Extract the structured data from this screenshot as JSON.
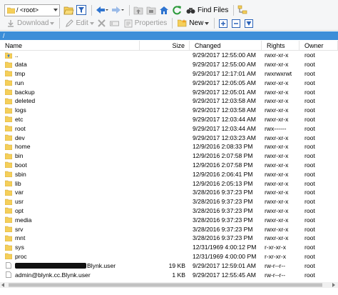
{
  "toolbar1": {
    "dir_select_value": "/ <root>",
    "find_files_label": "Find Files"
  },
  "toolbar2": {
    "download_label": "Download",
    "edit_label": "Edit",
    "properties_label": "Properties",
    "new_label": "New"
  },
  "path": "/",
  "columns": {
    "name": "Name",
    "size": "Size",
    "changed": "Changed",
    "rights": "Rights",
    "owner": "Owner"
  },
  "rows": [
    {
      "name": "..",
      "type": "parent",
      "size": "",
      "changed": "9/29/2017 12:55:00 AM",
      "rights": "rwxr-xr-x",
      "owner": "root"
    },
    {
      "name": "data",
      "type": "folder",
      "size": "",
      "changed": "9/29/2017 12:55:00 AM",
      "rights": "rwxr-xr-x",
      "owner": "root"
    },
    {
      "name": "tmp",
      "type": "folder",
      "size": "",
      "changed": "9/29/2017 12:17:01 AM",
      "rights": "rwxrwxrwt",
      "owner": "root"
    },
    {
      "name": "run",
      "type": "folder",
      "size": "",
      "changed": "9/29/2017 12:05:05 AM",
      "rights": "rwxr-xr-x",
      "owner": "root"
    },
    {
      "name": "backup",
      "type": "folder",
      "size": "",
      "changed": "9/29/2017 12:05:01 AM",
      "rights": "rwxr-xr-x",
      "owner": "root"
    },
    {
      "name": "deleted",
      "type": "folder",
      "size": "",
      "changed": "9/29/2017 12:03:58 AM",
      "rights": "rwxr-xr-x",
      "owner": "root"
    },
    {
      "name": "logs",
      "type": "folder",
      "size": "",
      "changed": "9/29/2017 12:03:58 AM",
      "rights": "rwxr-xr-x",
      "owner": "root"
    },
    {
      "name": "etc",
      "type": "folder",
      "size": "",
      "changed": "9/29/2017 12:03:44 AM",
      "rights": "rwxr-xr-x",
      "owner": "root"
    },
    {
      "name": "root",
      "type": "folder",
      "size": "",
      "changed": "9/29/2017 12:03:44 AM",
      "rights": "rwx------",
      "owner": "root"
    },
    {
      "name": "dev",
      "type": "folder",
      "size": "",
      "changed": "9/29/2017 12:03:23 AM",
      "rights": "rwxr-xr-x",
      "owner": "root"
    },
    {
      "name": "home",
      "type": "folder",
      "size": "",
      "changed": "12/9/2016 2:08:33 PM",
      "rights": "rwxr-xr-x",
      "owner": "root"
    },
    {
      "name": "bin",
      "type": "folder",
      "size": "",
      "changed": "12/9/2016 2:07:58 PM",
      "rights": "rwxr-xr-x",
      "owner": "root"
    },
    {
      "name": "boot",
      "type": "folder",
      "size": "",
      "changed": "12/9/2016 2:07:58 PM",
      "rights": "rwxr-xr-x",
      "owner": "root"
    },
    {
      "name": "sbin",
      "type": "folder",
      "size": "",
      "changed": "12/9/2016 2:06:41 PM",
      "rights": "rwxr-xr-x",
      "owner": "root"
    },
    {
      "name": "lib",
      "type": "folder",
      "size": "",
      "changed": "12/9/2016 2:05:13 PM",
      "rights": "rwxr-xr-x",
      "owner": "root"
    },
    {
      "name": "var",
      "type": "folder",
      "size": "",
      "changed": "3/28/2016 9:37:23 PM",
      "rights": "rwxr-xr-x",
      "owner": "root"
    },
    {
      "name": "usr",
      "type": "folder",
      "size": "",
      "changed": "3/28/2016 9:37:23 PM",
      "rights": "rwxr-xr-x",
      "owner": "root"
    },
    {
      "name": "opt",
      "type": "folder",
      "size": "",
      "changed": "3/28/2016 9:37:23 PM",
      "rights": "rwxr-xr-x",
      "owner": "root"
    },
    {
      "name": "media",
      "type": "folder",
      "size": "",
      "changed": "3/28/2016 9:37:23 PM",
      "rights": "rwxr-xr-x",
      "owner": "root"
    },
    {
      "name": "srv",
      "type": "folder",
      "size": "",
      "changed": "3/28/2016 9:37:23 PM",
      "rights": "rwxr-xr-x",
      "owner": "root"
    },
    {
      "name": "mnt",
      "type": "folder",
      "size": "",
      "changed": "3/28/2016 9:37:23 PM",
      "rights": "rwxr-xr-x",
      "owner": "root"
    },
    {
      "name": "sys",
      "type": "folder",
      "size": "",
      "changed": "12/31/1969 4:00:12 PM",
      "rights": "r-xr-xr-x",
      "owner": "root"
    },
    {
      "name": "proc",
      "type": "folder",
      "size": "",
      "changed": "12/31/1969 4:00:00 PM",
      "rights": "r-xr-xr-x",
      "owner": "root"
    },
    {
      "name": "Blynk.user",
      "type": "file",
      "redacted_prefix": true,
      "size": "19 KB",
      "changed": "9/29/2017 12:59:01 AM",
      "rights": "rw-r--r--",
      "owner": "root"
    },
    {
      "name": "admin@blynk.cc.Blynk.user",
      "type": "file",
      "size": "1 KB",
      "changed": "9/29/2017 12:55:45 AM",
      "rights": "rw-r--r--",
      "owner": "root"
    }
  ],
  "colors": {
    "folder": "#f5cf5a",
    "path_bar": "#3d8ed8",
    "toolbar_bg": "#f5f6f7"
  }
}
